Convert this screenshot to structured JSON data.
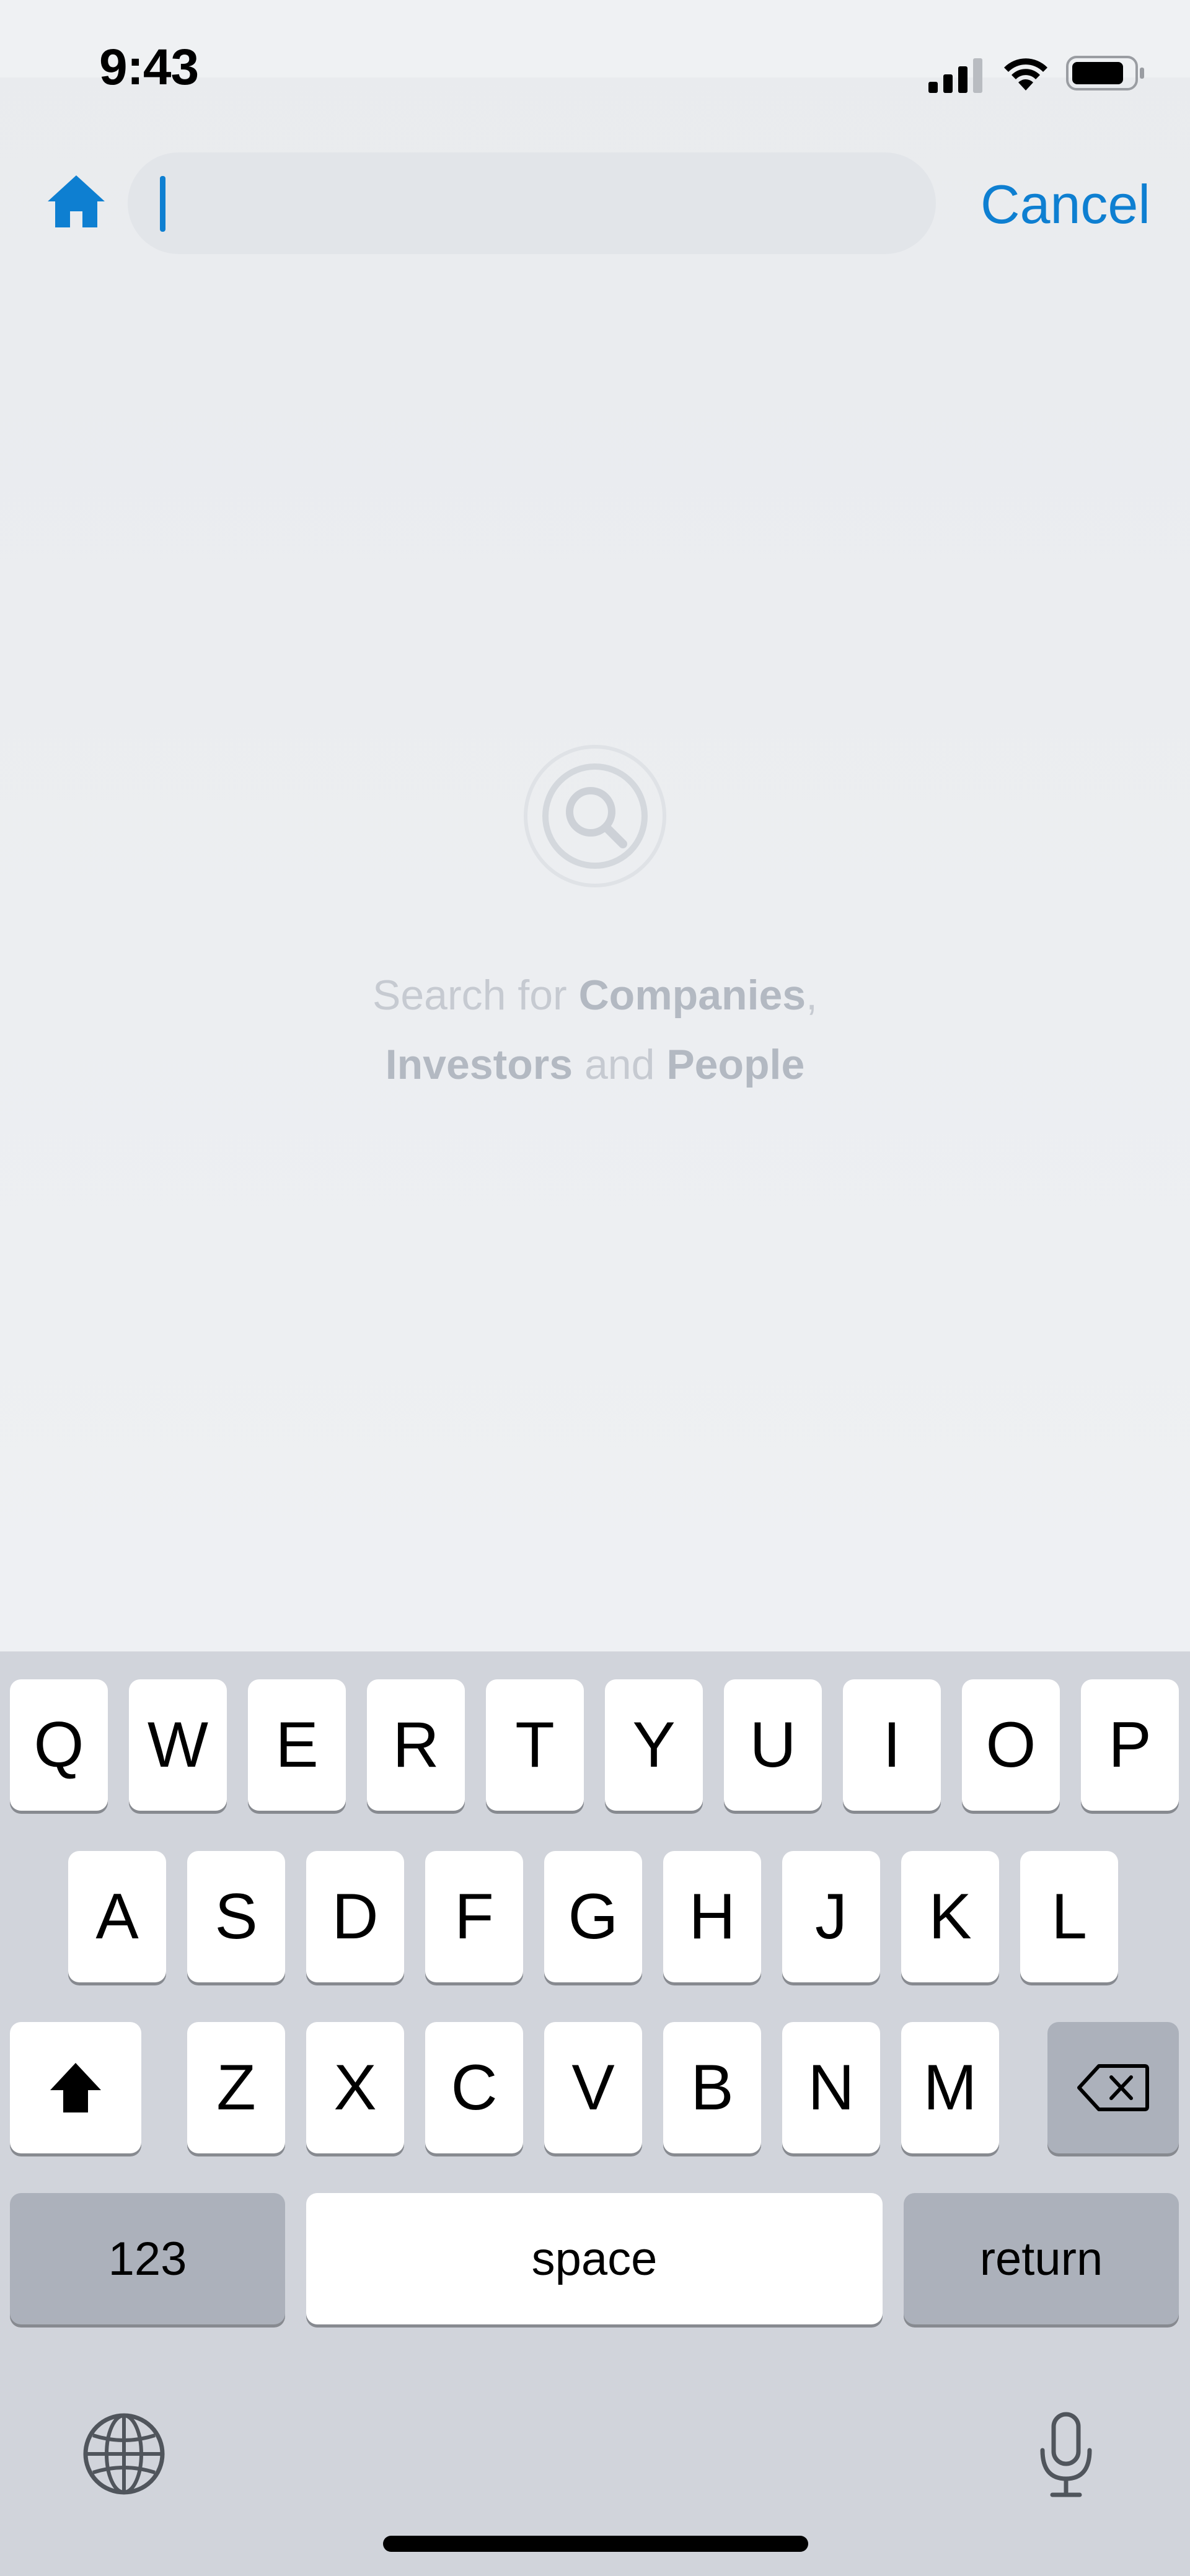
{
  "status_bar": {
    "time": "9:43"
  },
  "search": {
    "value": "",
    "placeholder": "",
    "cancel_label": "Cancel"
  },
  "empty_state": {
    "line1_prefix": "Search for ",
    "companies": "Companies",
    "comma": ",",
    "investors": "Investors",
    "and": " and ",
    "people": "People"
  },
  "keyboard": {
    "row1": [
      "Q",
      "W",
      "E",
      "R",
      "T",
      "Y",
      "U",
      "I",
      "O",
      "P"
    ],
    "row2": [
      "A",
      "S",
      "D",
      "F",
      "G",
      "H",
      "J",
      "K",
      "L"
    ],
    "row3": [
      "Z",
      "X",
      "C",
      "V",
      "B",
      "N",
      "M"
    ],
    "numbers_label": "123",
    "space_label": "space",
    "return_label": "return"
  },
  "colors": {
    "accent": "#0e7fd1",
    "background": "#eef0f3",
    "keyboard_bg": "#d1d4db",
    "key_dark": "#acb1bb"
  },
  "icons": {
    "home": "home-icon",
    "search": "magnifier-icon",
    "shift": "shift-icon",
    "backspace": "backspace-icon",
    "globe": "globe-icon",
    "mic": "microphone-icon",
    "signal": "cellular-signal-icon",
    "wifi": "wifi-icon",
    "battery": "battery-icon"
  }
}
